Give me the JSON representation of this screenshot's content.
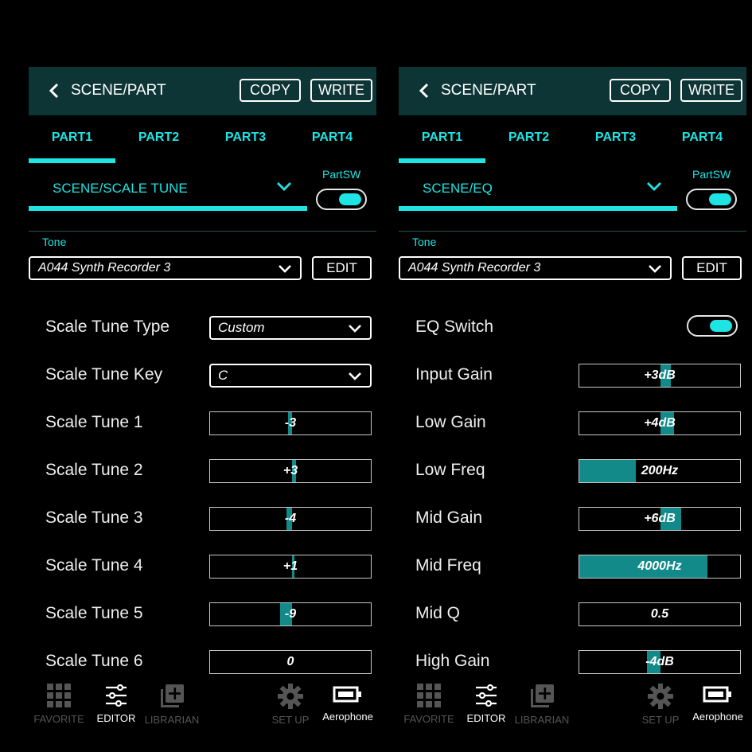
{
  "header": {
    "title": "SCENE/PART",
    "copy_label": "COPY",
    "write_label": "WRITE"
  },
  "tabs": [
    "PART1",
    "PART2",
    "PART3",
    "PART4"
  ],
  "partsw_label": "PartSW",
  "tone": {
    "label": "Tone",
    "value": "A044 Synth Recorder 3",
    "edit_label": "EDIT"
  },
  "left": {
    "section": "SCENE/SCALE TUNE",
    "params": [
      {
        "label": "Scale Tune Type",
        "kind": "dropdown",
        "value": "Custom"
      },
      {
        "label": "Scale Tune Key",
        "kind": "dropdown",
        "value": "C"
      },
      {
        "label": "Scale Tune 1",
        "kind": "bar",
        "value": "-3",
        "level": -3,
        "range": [
          -64,
          63
        ]
      },
      {
        "label": "Scale Tune 2",
        "kind": "bar",
        "value": "+3",
        "level": 3,
        "range": [
          -64,
          63
        ]
      },
      {
        "label": "Scale Tune 3",
        "kind": "bar",
        "value": "-4",
        "level": -4,
        "range": [
          -64,
          63
        ]
      },
      {
        "label": "Scale Tune 4",
        "kind": "bar",
        "value": "+1",
        "level": 1,
        "range": [
          -64,
          63
        ]
      },
      {
        "label": "Scale Tune 5",
        "kind": "bar",
        "value": "-9",
        "level": -9,
        "range": [
          -64,
          63
        ]
      },
      {
        "label": "Scale Tune 6",
        "kind": "bar",
        "value": "0",
        "level": 0,
        "range": [
          -64,
          63
        ]
      }
    ]
  },
  "right": {
    "section": "SCENE/EQ",
    "params": [
      {
        "label": "EQ Switch",
        "kind": "toggle",
        "value": "on"
      },
      {
        "label": "Input Gain",
        "kind": "bar",
        "value": "+3dB",
        "level": 3,
        "range": [
          -24,
          24
        ]
      },
      {
        "label": "Low Gain",
        "kind": "bar",
        "value": "+4dB",
        "level": 4,
        "range": [
          -24,
          24
        ]
      },
      {
        "label": "Low Freq",
        "kind": "bar",
        "value": "200Hz",
        "fraction": 0.35
      },
      {
        "label": "Mid Gain",
        "kind": "bar",
        "value": "+6dB",
        "level": 6,
        "range": [
          -24,
          24
        ]
      },
      {
        "label": "Mid Freq",
        "kind": "bar",
        "value": "4000Hz",
        "fraction": 0.79
      },
      {
        "label": "Mid Q",
        "kind": "bar",
        "value": "0.5",
        "fraction": 0
      },
      {
        "label": "High Gain",
        "kind": "bar",
        "value": "-4dB",
        "level": -4,
        "range": [
          -24,
          24
        ]
      }
    ]
  },
  "nav": [
    {
      "label": "FAVORITE",
      "icon": "grid-icon",
      "active": false
    },
    {
      "label": "EDITOR",
      "icon": "sliders-icon",
      "active": true
    },
    {
      "label": "LIBRARIAN",
      "icon": "library-add-icon",
      "active": false
    },
    {
      "label": "SET UP",
      "icon": "gear-icon",
      "active": false
    },
    {
      "label": "Aerophone",
      "icon": "battery-icon",
      "active": true
    }
  ],
  "colors": {
    "accent": "#1ee4e4",
    "header_bg": "#0e3536",
    "bar_fill": "#128a8a",
    "background": "#000000"
  }
}
